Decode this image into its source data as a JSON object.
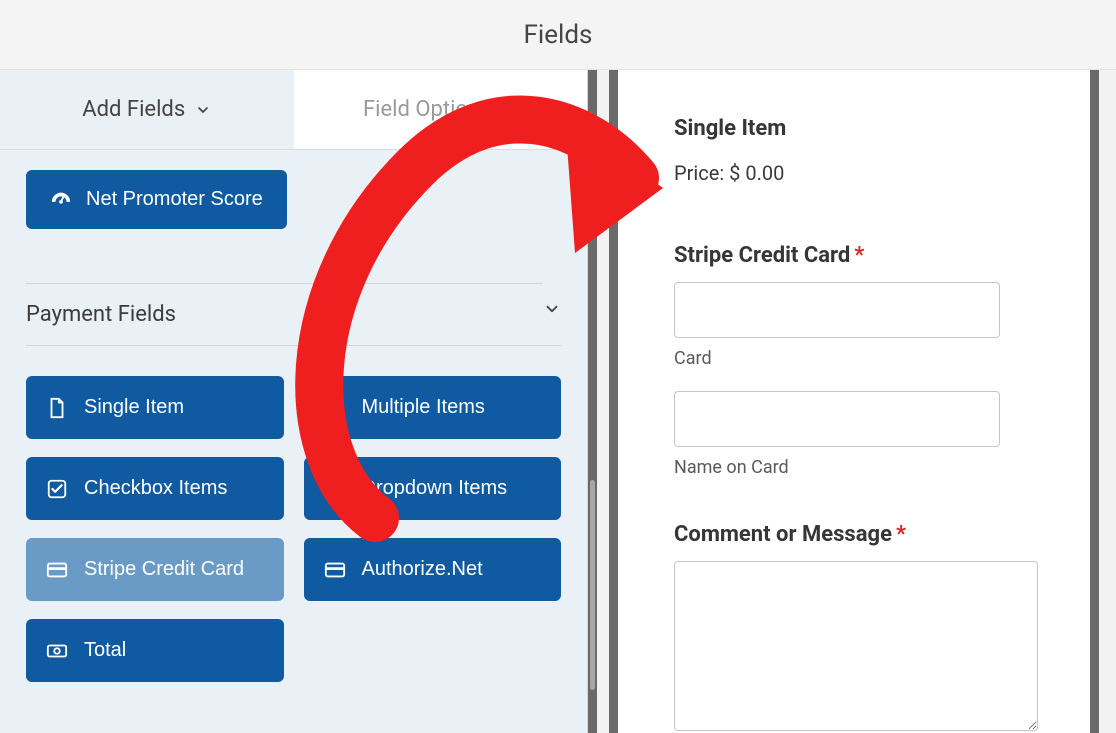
{
  "header": {
    "title": "Fields"
  },
  "tabs": {
    "add_label": "Add Fields",
    "options_label": "Field Options"
  },
  "nps_label": "Net Promoter Score",
  "payment_section": {
    "title": "Payment Fields",
    "items": [
      {
        "key": "single-item",
        "label": "Single Item",
        "icon": "file-icon"
      },
      {
        "key": "multiple-items",
        "label": "Multiple Items",
        "icon": "list-icon"
      },
      {
        "key": "checkbox-items",
        "label": "Checkbox Items",
        "icon": "checkbox-icon"
      },
      {
        "key": "dropdown-items",
        "label": "Dropdown Items",
        "icon": "dropdown-icon"
      },
      {
        "key": "stripe-credit-card",
        "label": "Stripe Credit Card",
        "icon": "card-icon",
        "faded": true
      },
      {
        "key": "authorize-net",
        "label": "Authorize.Net",
        "icon": "card-icon"
      },
      {
        "key": "total",
        "label": "Total",
        "icon": "money-icon"
      }
    ]
  },
  "preview": {
    "item_heading": "Single Item",
    "price_label": "Price: $ 0.00",
    "stripe_label": "Stripe Credit Card",
    "card_sublabel": "Card",
    "name_sublabel": "Name on Card",
    "comment_label": "Comment or Message"
  },
  "annotation": {
    "color": "#ef1f1f"
  }
}
